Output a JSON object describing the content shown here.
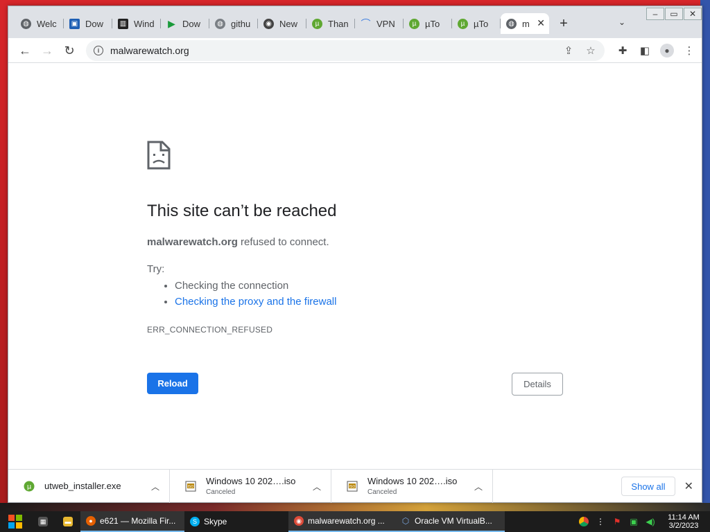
{
  "tabs": [
    {
      "label": "Welc",
      "icon": "globe-icon"
    },
    {
      "label": "Dow",
      "icon": "download-site-icon"
    },
    {
      "label": "Wind",
      "icon": "windows-site-icon"
    },
    {
      "label": "Dow",
      "icon": "play-icon"
    },
    {
      "label": "githu",
      "icon": "globe-icon"
    },
    {
      "label": "New",
      "icon": "chrome-icon"
    },
    {
      "label": "Than",
      "icon": "utorrent-icon"
    },
    {
      "label": "VPN",
      "icon": "vpn-icon"
    },
    {
      "label": "µTo",
      "icon": "utorrent-icon"
    },
    {
      "label": "µTo",
      "icon": "utorrent-icon"
    },
    {
      "label": "m",
      "icon": "globe-icon"
    }
  ],
  "toolbar": {
    "url": "malwarewatch.org"
  },
  "error": {
    "title": "This site can’t be reached",
    "domain": "malwarewatch.org",
    "desc_suffix": " refused to connect.",
    "try_label": "Try:",
    "suggestions": [
      "Checking the connection",
      "Checking the proxy and the firewall"
    ],
    "code": "ERR_CONNECTION_REFUSED",
    "reload_label": "Reload",
    "details_label": "Details"
  },
  "downloads": {
    "items": [
      {
        "name": "utweb_installer.exe",
        "status": ""
      },
      {
        "name": "Windows 10  202….iso",
        "status": "Canceled"
      },
      {
        "name": "Windows 10  202….iso",
        "status": "Canceled"
      }
    ],
    "show_all_label": "Show all"
  },
  "taskbar": {
    "apps": [
      {
        "label": "e621 — Mozilla Fir...",
        "icon": "firefox-icon"
      },
      {
        "label": "Skype",
        "icon": "skype-icon"
      },
      {
        "label": "malwarewatch.org ...",
        "icon": "chrome-icon"
      },
      {
        "label": "Oracle VM VirtualB...",
        "icon": "virtualbox-icon"
      }
    ],
    "time": "11:14 AM",
    "date": "3/2/2023"
  },
  "colors": {
    "accent": "#1a73e8",
    "text_secondary": "#5f6368"
  }
}
